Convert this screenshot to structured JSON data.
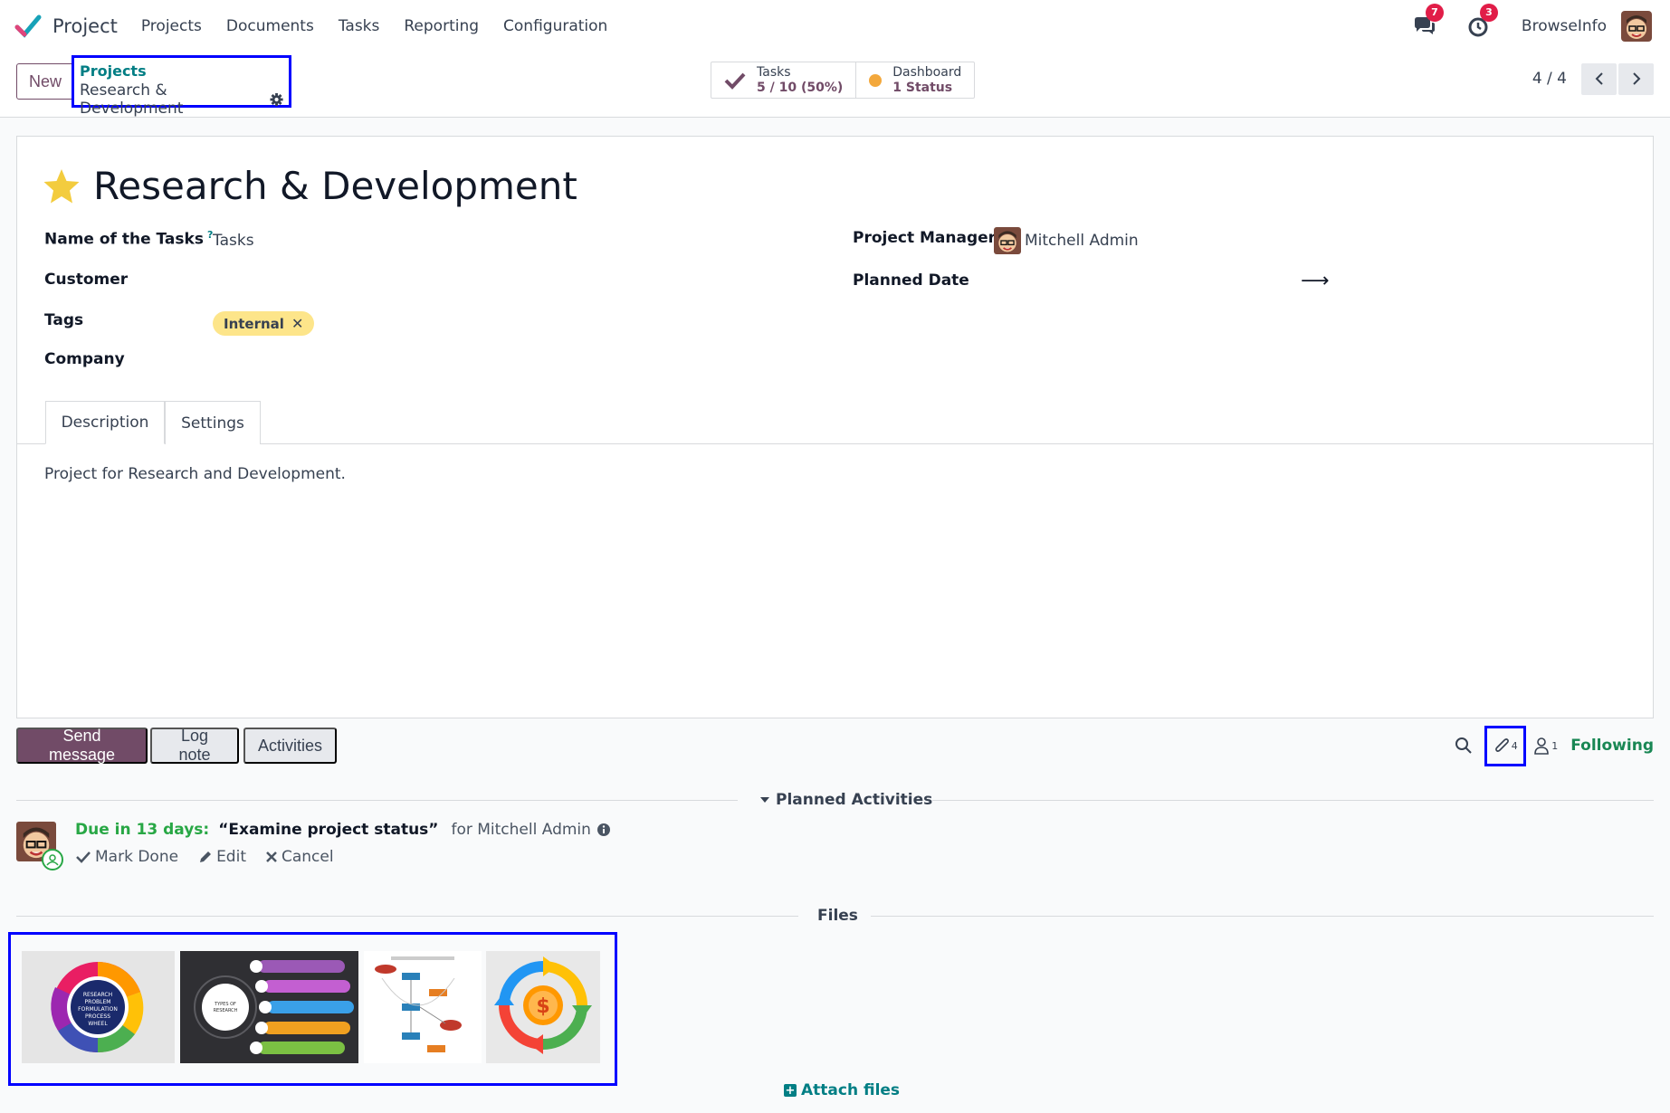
{
  "navbar": {
    "app_name": "Project",
    "menu": [
      "Projects",
      "Documents",
      "Tasks",
      "Reporting",
      "Configuration"
    ],
    "messages_count": "7",
    "activities_count": "3",
    "company": "BrowseInfo"
  },
  "control": {
    "new_label": "New",
    "breadcrumb_parent": "Projects",
    "breadcrumb_current": "Research & Development",
    "tasks_label": "Tasks",
    "tasks_value": "5 / 10 (50%)",
    "dashboard_label": "Dashboard",
    "dashboard_value": "1 Status",
    "pager": "4 / 4"
  },
  "form": {
    "title": "Research & Development",
    "fields": {
      "tasks_label": "Name of the Tasks",
      "tasks_help": "?",
      "tasks_value": "Tasks",
      "customer_label": "Customer",
      "tags_label": "Tags",
      "tag": "Internal",
      "company_label": "Company",
      "manager_label": "Project Manager",
      "manager_value": "Mitchell Admin",
      "planned_label": "Planned Date",
      "planned_arrow": "⟶"
    },
    "tabs": [
      "Description",
      "Settings"
    ],
    "description": "Project for Research and Development."
  },
  "chatter": {
    "send_message": "Send message",
    "log_note": "Log note",
    "activities": "Activities",
    "attachment_count": "4",
    "follower_count": "1",
    "following": "Following",
    "planned_title": "Planned Activities",
    "activity": {
      "due": "Due in 13 days:",
      "summary": "“Examine project status”",
      "for": "for Mitchell Admin",
      "mark_done": "Mark Done",
      "edit": "Edit",
      "cancel": "Cancel"
    },
    "files_title": "Files",
    "attach_files": "Attach files",
    "thumb1_text": "RESEARCH PROBLEM FORMULATION PROCESS WHEEL",
    "thumb2_text": "TYPES OF RESEARCH"
  },
  "colors": {
    "brand": "#714b67",
    "teal": "#017e84",
    "highlight": "#0000ff",
    "tag": "#fde58a",
    "due": "#28a745"
  }
}
